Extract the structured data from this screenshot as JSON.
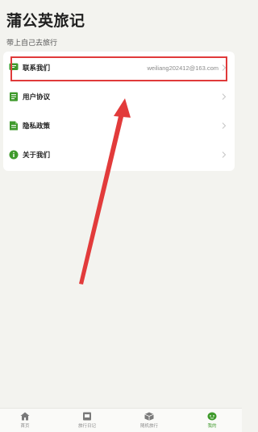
{
  "header": {
    "title": "蒲公英旅记",
    "subtitle": "带上自己去旅行"
  },
  "menu": {
    "items": [
      {
        "label": "联系我们",
        "value": "weiliang202412@163.com",
        "icon": "chat-icon"
      },
      {
        "label": "用户协议",
        "value": "",
        "icon": "document-icon"
      },
      {
        "label": "隐私政策",
        "value": "",
        "icon": "policy-icon"
      },
      {
        "label": "关于我们",
        "value": "",
        "icon": "info-icon"
      }
    ]
  },
  "tabbar": {
    "items": [
      {
        "label": "首页",
        "icon": "home-icon",
        "active": false
      },
      {
        "label": "旅行日记",
        "icon": "diary-icon",
        "active": false
      },
      {
        "label": "随机旅行",
        "icon": "box-icon",
        "active": false
      },
      {
        "label": "我的",
        "icon": "profile-icon",
        "active": true
      }
    ]
  },
  "colors": {
    "accent": "#3f9a2c",
    "highlight": "#e03a3a",
    "background": "#f3f3ef"
  }
}
